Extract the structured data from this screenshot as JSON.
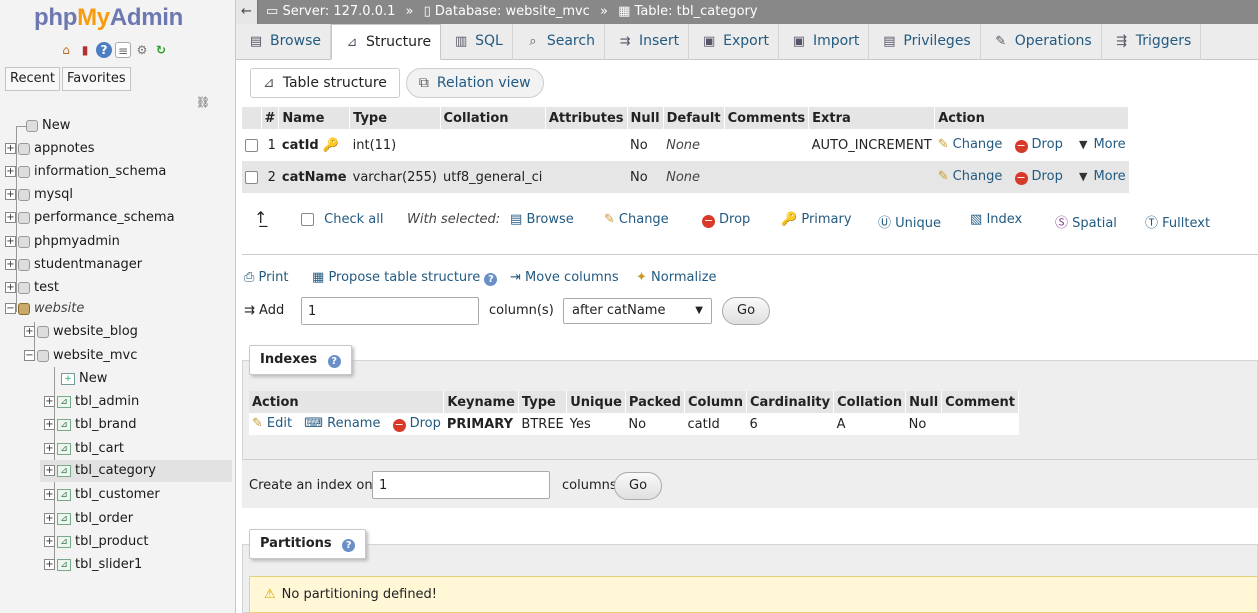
{
  "logo": {
    "php": "php",
    "my": "My",
    "admin": "Admin"
  },
  "sidebar": {
    "quick_icons": [
      "home-icon",
      "exit-icon",
      "help-icon",
      "docs-icon",
      "settings-icon",
      "reload-icon"
    ],
    "recent_label": "Recent",
    "favorites_label": "Favorites",
    "tree": {
      "new": "New",
      "databases": [
        "appnotes",
        "information_schema",
        "mysql",
        "performance_schema",
        "phpmyadmin",
        "studentmanager",
        "test"
      ],
      "website": "website",
      "website_children": [
        "website_blog",
        "website_mvc"
      ],
      "mvc_new": "New",
      "tables": [
        "tbl_admin",
        "tbl_brand",
        "tbl_cart",
        "tbl_category",
        "tbl_customer",
        "tbl_order",
        "tbl_product",
        "tbl_slider1"
      ]
    }
  },
  "breadcrumb": {
    "server": "Server: 127.0.0.1",
    "database": "Database: website_mvc",
    "table": "Table: tbl_category",
    "sep": "»"
  },
  "tabs": [
    "Browse",
    "Structure",
    "SQL",
    "Search",
    "Insert",
    "Export",
    "Import",
    "Privileges",
    "Operations",
    "Triggers"
  ],
  "subtabs": [
    "Table structure",
    "Relation view"
  ],
  "structure": {
    "headers": [
      "#",
      "Name",
      "Type",
      "Collation",
      "Attributes",
      "Null",
      "Default",
      "Comments",
      "Extra",
      "Action"
    ],
    "rows": [
      {
        "num": "1",
        "name": "catId",
        "type": "int(11)",
        "collation": "",
        "attributes": "",
        "null": "No",
        "default": "None",
        "comments": "",
        "extra": "AUTO_INCREMENT"
      },
      {
        "num": "2",
        "name": "catName",
        "type": "varchar(255)",
        "collation": "utf8_general_ci",
        "attributes": "",
        "null": "No",
        "default": "None",
        "comments": "",
        "extra": ""
      }
    ],
    "row_actions": {
      "change": "Change",
      "drop": "Drop",
      "more": "More"
    }
  },
  "bulk": {
    "check_all": "Check all",
    "with_selected": "With selected:",
    "actions": [
      "Browse",
      "Change",
      "Drop",
      "Primary",
      "Unique",
      "Index",
      "Spatial",
      "Fulltext"
    ]
  },
  "tools": {
    "print": "Print",
    "propose": "Propose table structure",
    "move": "Move columns",
    "normalize": "Normalize"
  },
  "add_columns": {
    "label": "Add",
    "value": "1",
    "suffix": "column(s)",
    "position": "after catName",
    "go": "Go"
  },
  "indexes": {
    "legend": "Indexes",
    "headers": [
      "Action",
      "Keyname",
      "Type",
      "Unique",
      "Packed",
      "Column",
      "Cardinality",
      "Collation",
      "Null",
      "Comment"
    ],
    "actions": {
      "edit": "Edit",
      "rename": "Rename",
      "drop": "Drop"
    },
    "rows": [
      {
        "keyname": "PRIMARY",
        "type": "BTREE",
        "unique": "Yes",
        "packed": "No",
        "column": "catId",
        "cardinality": "6",
        "collation": "A",
        "null": "No",
        "comment": ""
      }
    ],
    "create_label": "Create an index on",
    "create_value": "1",
    "create_suffix": "columns",
    "go": "Go"
  },
  "partitions": {
    "legend": "Partitions",
    "message": "No partitioning defined!"
  }
}
